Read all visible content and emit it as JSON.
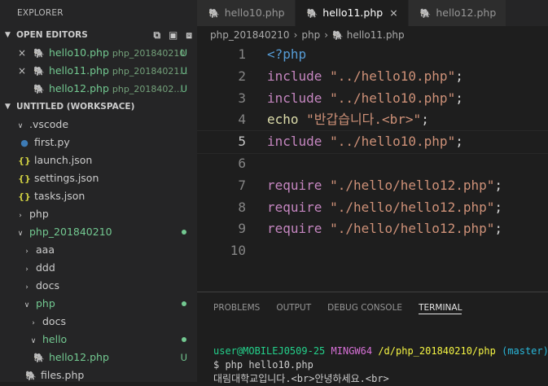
{
  "sidebar": {
    "title": "EXPLORER",
    "open_editors": {
      "title": "OPEN EDITORS",
      "items": [
        {
          "name": "hello10.php",
          "desc": "php_201840210",
          "badge": "U",
          "close": "×"
        },
        {
          "name": "hello11.php",
          "desc": "php_20184021...",
          "badge": "U",
          "close": "×"
        },
        {
          "name": "hello12.php",
          "desc": "php_2018402...",
          "badge": "U"
        }
      ]
    },
    "workspace": {
      "title": "UNTITLED (WORKSPACE)",
      "items": [
        {
          "label": ".vscode"
        },
        {
          "label": "first.py"
        },
        {
          "label": "launch.json"
        },
        {
          "label": "settings.json"
        },
        {
          "label": "tasks.json"
        },
        {
          "label": "php"
        },
        {
          "label": "php_201840210"
        },
        {
          "label": "aaa"
        },
        {
          "label": "ddd"
        },
        {
          "label": "docs"
        },
        {
          "label": "php"
        },
        {
          "label": "docs"
        },
        {
          "label": "hello"
        },
        {
          "label": "hello12.php",
          "badge": "U"
        },
        {
          "label": "files.php"
        }
      ]
    }
  },
  "tabs": [
    {
      "label": "hello10.php"
    },
    {
      "label": "hello11.php",
      "close": "×"
    },
    {
      "label": "hello12.php"
    }
  ],
  "breadcrumb": {
    "parts": [
      "php_201840210",
      "php",
      "hello11.php"
    ],
    "sep": "›"
  },
  "editor": {
    "lines": [
      {
        "n": "1",
        "a": "<?php",
        "b": "",
        "c": ""
      },
      {
        "n": "2",
        "a": "include",
        "b": " \"../hello10.php\"",
        "c": ";"
      },
      {
        "n": "3",
        "a": "include",
        "b": " \"../hello10.php\"",
        "c": ";"
      },
      {
        "n": "4",
        "a": "echo",
        "b": " \"반갑습니다.<br>\"",
        "c": ";"
      },
      {
        "n": "5",
        "a": "include",
        "b": " \"../hello10.php\"",
        "c": ";"
      },
      {
        "n": "6",
        "a": "",
        "b": "",
        "c": ""
      },
      {
        "n": "7",
        "a": "require",
        "b": " \"./hello/hello12.php\"",
        "c": ";"
      },
      {
        "n": "8",
        "a": "require",
        "b": " \"./hello/hello12.php\"",
        "c": ";"
      },
      {
        "n": "9",
        "a": "require",
        "b": " \"./hello/hello12.php\"",
        "c": ";"
      },
      {
        "n": "10",
        "a": "",
        "b": "",
        "c": ""
      }
    ]
  },
  "panel": {
    "tabs": [
      "PROBLEMS",
      "OUTPUT",
      "DEBUG CONSOLE",
      "TERMINAL"
    ],
    "terminal": {
      "user": "user@MOBILEJ0509-25",
      "host": "MINGW64",
      "path": "/d/php_201840210/php",
      "branch": "(master)",
      "command": "$ php hello10.php",
      "output": "대림대학교입니다.<br>안녕하세요.<br>"
    }
  },
  "icons": {
    "php": "🐘",
    "json": "{}",
    "py": "py"
  }
}
